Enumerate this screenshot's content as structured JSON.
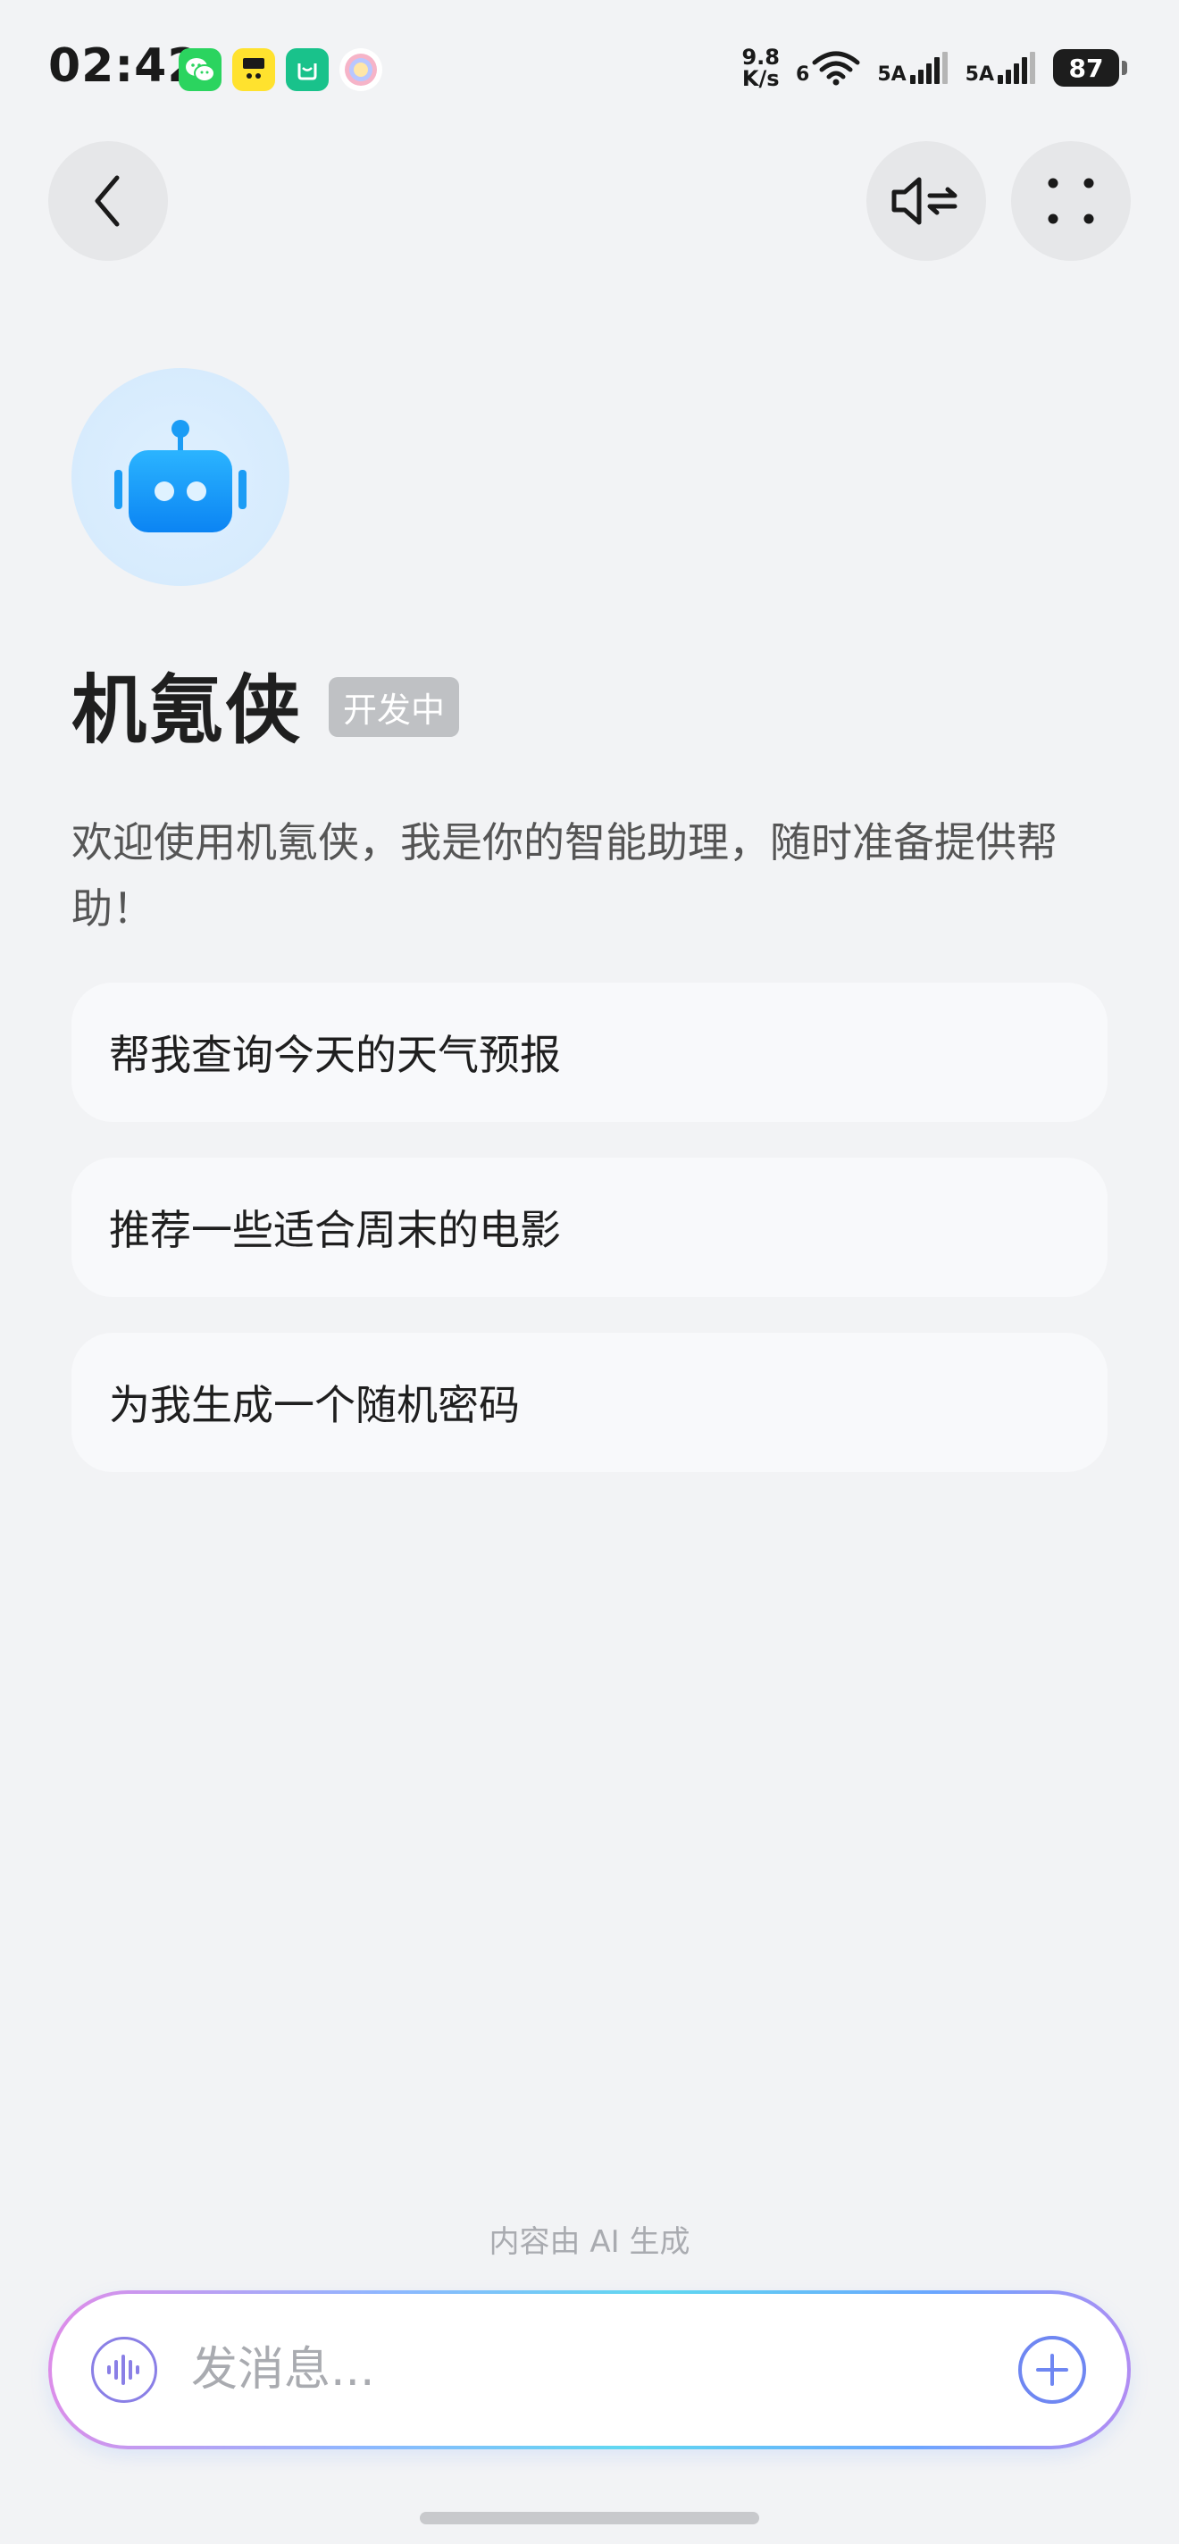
{
  "status_bar": {
    "time": "02:42",
    "net_speed_value": "9.8",
    "net_speed_unit": "K/s",
    "wifi_label": "6",
    "sim1_label": "5A",
    "sim2_label": "5A",
    "battery": "87",
    "app_icons": [
      "wechat-icon",
      "nova-app-icon",
      "mi-home-icon",
      "photo-app-icon"
    ]
  },
  "header": {
    "back_icon": "chevron-left-icon",
    "voice_icon": "speaker-switch-icon",
    "more_icon": "four-dots-icon"
  },
  "bot": {
    "avatar_icon": "robot-icon",
    "name": "机氪侠",
    "badge": "开发中",
    "welcome": "欢迎使用机氪侠，我是你的智能助理，随时准备提供帮助！"
  },
  "suggestions": [
    "帮我查询今天的天气预报",
    "推荐一些适合周末的电影",
    "为我生成一个随机密码"
  ],
  "footer": {
    "ai_note": "内容由 AI 生成",
    "input_placeholder": "发消息...",
    "voice_icon": "audio-wave-icon",
    "plus_icon": "plus-circle-icon"
  },
  "colors": {
    "background": "#f2f3f5",
    "robot_blue": "#1593f7",
    "badge_gray": "#bfc1c4"
  }
}
